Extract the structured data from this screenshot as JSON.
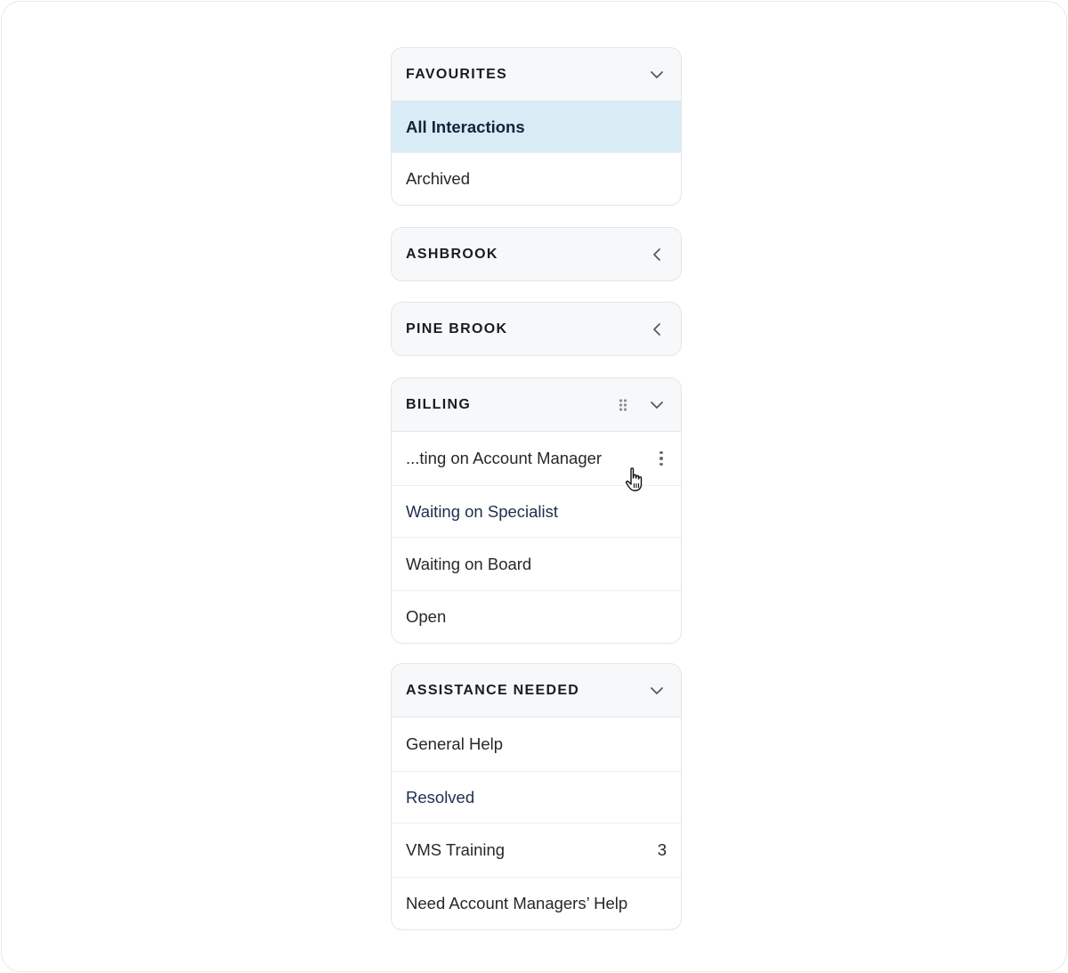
{
  "panels": [
    {
      "title": "FAVOURITES",
      "state": "expanded",
      "items": [
        {
          "label": "All Interactions",
          "selected": true
        },
        {
          "label": "Archived"
        }
      ]
    },
    {
      "title": "ASHBROOK",
      "state": "collapsed",
      "items": []
    },
    {
      "title": "PINE BROOK",
      "state": "collapsed",
      "items": []
    },
    {
      "title": "BILLING",
      "state": "expanded",
      "has_drag_handle": true,
      "items": [
        {
          "label": "...ting on Account Manager",
          "hovered": true,
          "more_menu": true
        },
        {
          "label": "Waiting on Specialist",
          "style": "link"
        },
        {
          "label": "Waiting on Board"
        },
        {
          "label": "Open"
        }
      ]
    },
    {
      "title": "ASSISTANCE NEEDED",
      "state": "expanded",
      "items": [
        {
          "label": "General Help"
        },
        {
          "label": "Resolved",
          "style": "link"
        },
        {
          "label": "VMS Training",
          "count": "3"
        },
        {
          "label": "Need Account Managers’ Help"
        }
      ]
    }
  ],
  "colors": {
    "selected_bg": "#d9ecf5",
    "header_bg": "#f7f8fa",
    "link_text": "#1f2e4d"
  },
  "icons": {
    "expanded": "chevron-down-icon",
    "collapsed": "chevron-left-icon",
    "drag": "drag-handle-icon",
    "more": "more-vertical-icon",
    "cursor": "hand-pointer-cursor"
  }
}
